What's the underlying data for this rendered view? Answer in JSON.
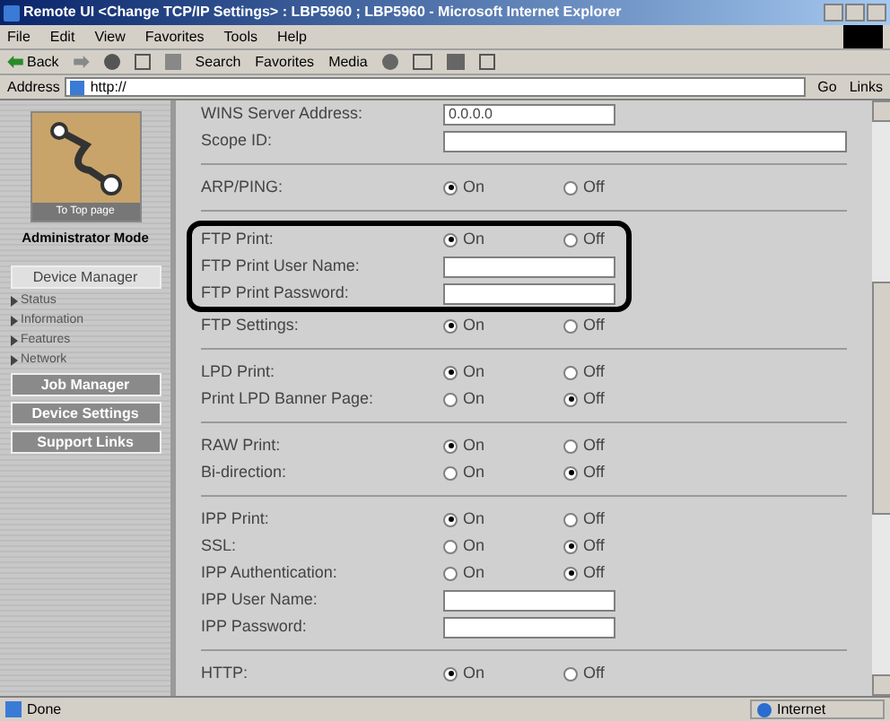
{
  "window": {
    "title": "Remote UI <Change TCP/IP Settings> : LBP5960 ; LBP5960 - Microsoft Internet Explorer"
  },
  "menu": [
    "File",
    "Edit",
    "View",
    "Favorites",
    "Tools",
    "Help"
  ],
  "toolbar": {
    "back": "Back",
    "search": "Search",
    "favorites": "Favorites",
    "media": "Media"
  },
  "address": {
    "label": "Address",
    "value": "http://",
    "go": "Go",
    "links": "Links"
  },
  "sidebar": {
    "logo_label": "To Top page",
    "mode": "Administrator Mode",
    "items": [
      {
        "label": "Device Manager",
        "kind": "main",
        "selected": true
      },
      {
        "label": "Status",
        "kind": "sub",
        "selected": false
      },
      {
        "label": "Information",
        "kind": "sub",
        "selected": false
      },
      {
        "label": "Features",
        "kind": "sub",
        "selected": false
      },
      {
        "label": "Network",
        "kind": "sub",
        "selected": false
      },
      {
        "label": "Job Manager",
        "kind": "main",
        "selected": false
      },
      {
        "label": "Device Settings",
        "kind": "main",
        "selected": false
      },
      {
        "label": "Support Links",
        "kind": "main",
        "selected": false
      }
    ]
  },
  "sections": [
    {
      "groups": [
        {
          "outlined": false,
          "rows": [
            {
              "label": "WINS Server Address:",
              "kind": "field",
              "value": "0.0.0.0"
            },
            {
              "label": "Scope ID:",
              "kind": "long-field",
              "value": ""
            }
          ]
        }
      ]
    },
    {
      "groups": [
        {
          "outlined": false,
          "rows": [
            {
              "label": "ARP/PING:",
              "kind": "radio",
              "options": [
                {
                  "label": "On",
                  "selected": true
                },
                {
                  "label": "Off",
                  "selected": false
                }
              ]
            }
          ]
        }
      ]
    },
    {
      "groups": [
        {
          "outlined": true,
          "rows": [
            {
              "label": "FTP Print:",
              "kind": "radio",
              "options": [
                {
                  "label": "On",
                  "selected": true
                },
                {
                  "label": "Off",
                  "selected": false
                }
              ]
            },
            {
              "label": "FTP Print User Name:",
              "kind": "field",
              "value": ""
            },
            {
              "label": "FTP Print Password:",
              "kind": "field",
              "value": ""
            }
          ]
        },
        {
          "outlined": false,
          "rows": [
            {
              "label": "FTP Settings:",
              "kind": "radio",
              "options": [
                {
                  "label": "On",
                  "selected": true
                },
                {
                  "label": "Off",
                  "selected": false
                }
              ]
            }
          ]
        }
      ]
    },
    {
      "groups": [
        {
          "outlined": false,
          "rows": [
            {
              "label": "LPD Print:",
              "kind": "radio",
              "options": [
                {
                  "label": "On",
                  "selected": true
                },
                {
                  "label": "Off",
                  "selected": false
                }
              ]
            },
            {
              "label": "Print LPD Banner Page:",
              "kind": "radio",
              "options": [
                {
                  "label": "On",
                  "selected": false
                },
                {
                  "label": "Off",
                  "selected": true
                }
              ]
            }
          ]
        }
      ]
    },
    {
      "groups": [
        {
          "outlined": false,
          "rows": [
            {
              "label": "RAW Print:",
              "kind": "radio",
              "options": [
                {
                  "label": "On",
                  "selected": true
                },
                {
                  "label": "Off",
                  "selected": false
                }
              ]
            },
            {
              "label": "Bi-direction:",
              "kind": "radio",
              "options": [
                {
                  "label": "On",
                  "selected": false
                },
                {
                  "label": "Off",
                  "selected": true
                }
              ]
            }
          ]
        }
      ]
    },
    {
      "groups": [
        {
          "outlined": false,
          "rows": [
            {
              "label": "IPP Print:",
              "kind": "radio",
              "options": [
                {
                  "label": "On",
                  "selected": true
                },
                {
                  "label": "Off",
                  "selected": false
                }
              ]
            },
            {
              "label": "SSL:",
              "kind": "radio",
              "options": [
                {
                  "label": "On",
                  "selected": false
                },
                {
                  "label": "Off",
                  "selected": true
                }
              ]
            },
            {
              "label": "IPP Authentication:",
              "kind": "radio",
              "options": [
                {
                  "label": "On",
                  "selected": false
                },
                {
                  "label": "Off",
                  "selected": true
                }
              ]
            },
            {
              "label": "IPP User Name:",
              "kind": "field",
              "value": ""
            },
            {
              "label": "IPP Password:",
              "kind": "field",
              "value": ""
            }
          ]
        }
      ]
    },
    {
      "groups": [
        {
          "outlined": false,
          "rows": [
            {
              "label": "HTTP:",
              "kind": "radio",
              "options": [
                {
                  "label": "On",
                  "selected": true
                },
                {
                  "label": "Off",
                  "selected": false
                }
              ]
            }
          ]
        }
      ]
    }
  ],
  "status_bar": {
    "text": "Done",
    "zone": "Internet"
  }
}
